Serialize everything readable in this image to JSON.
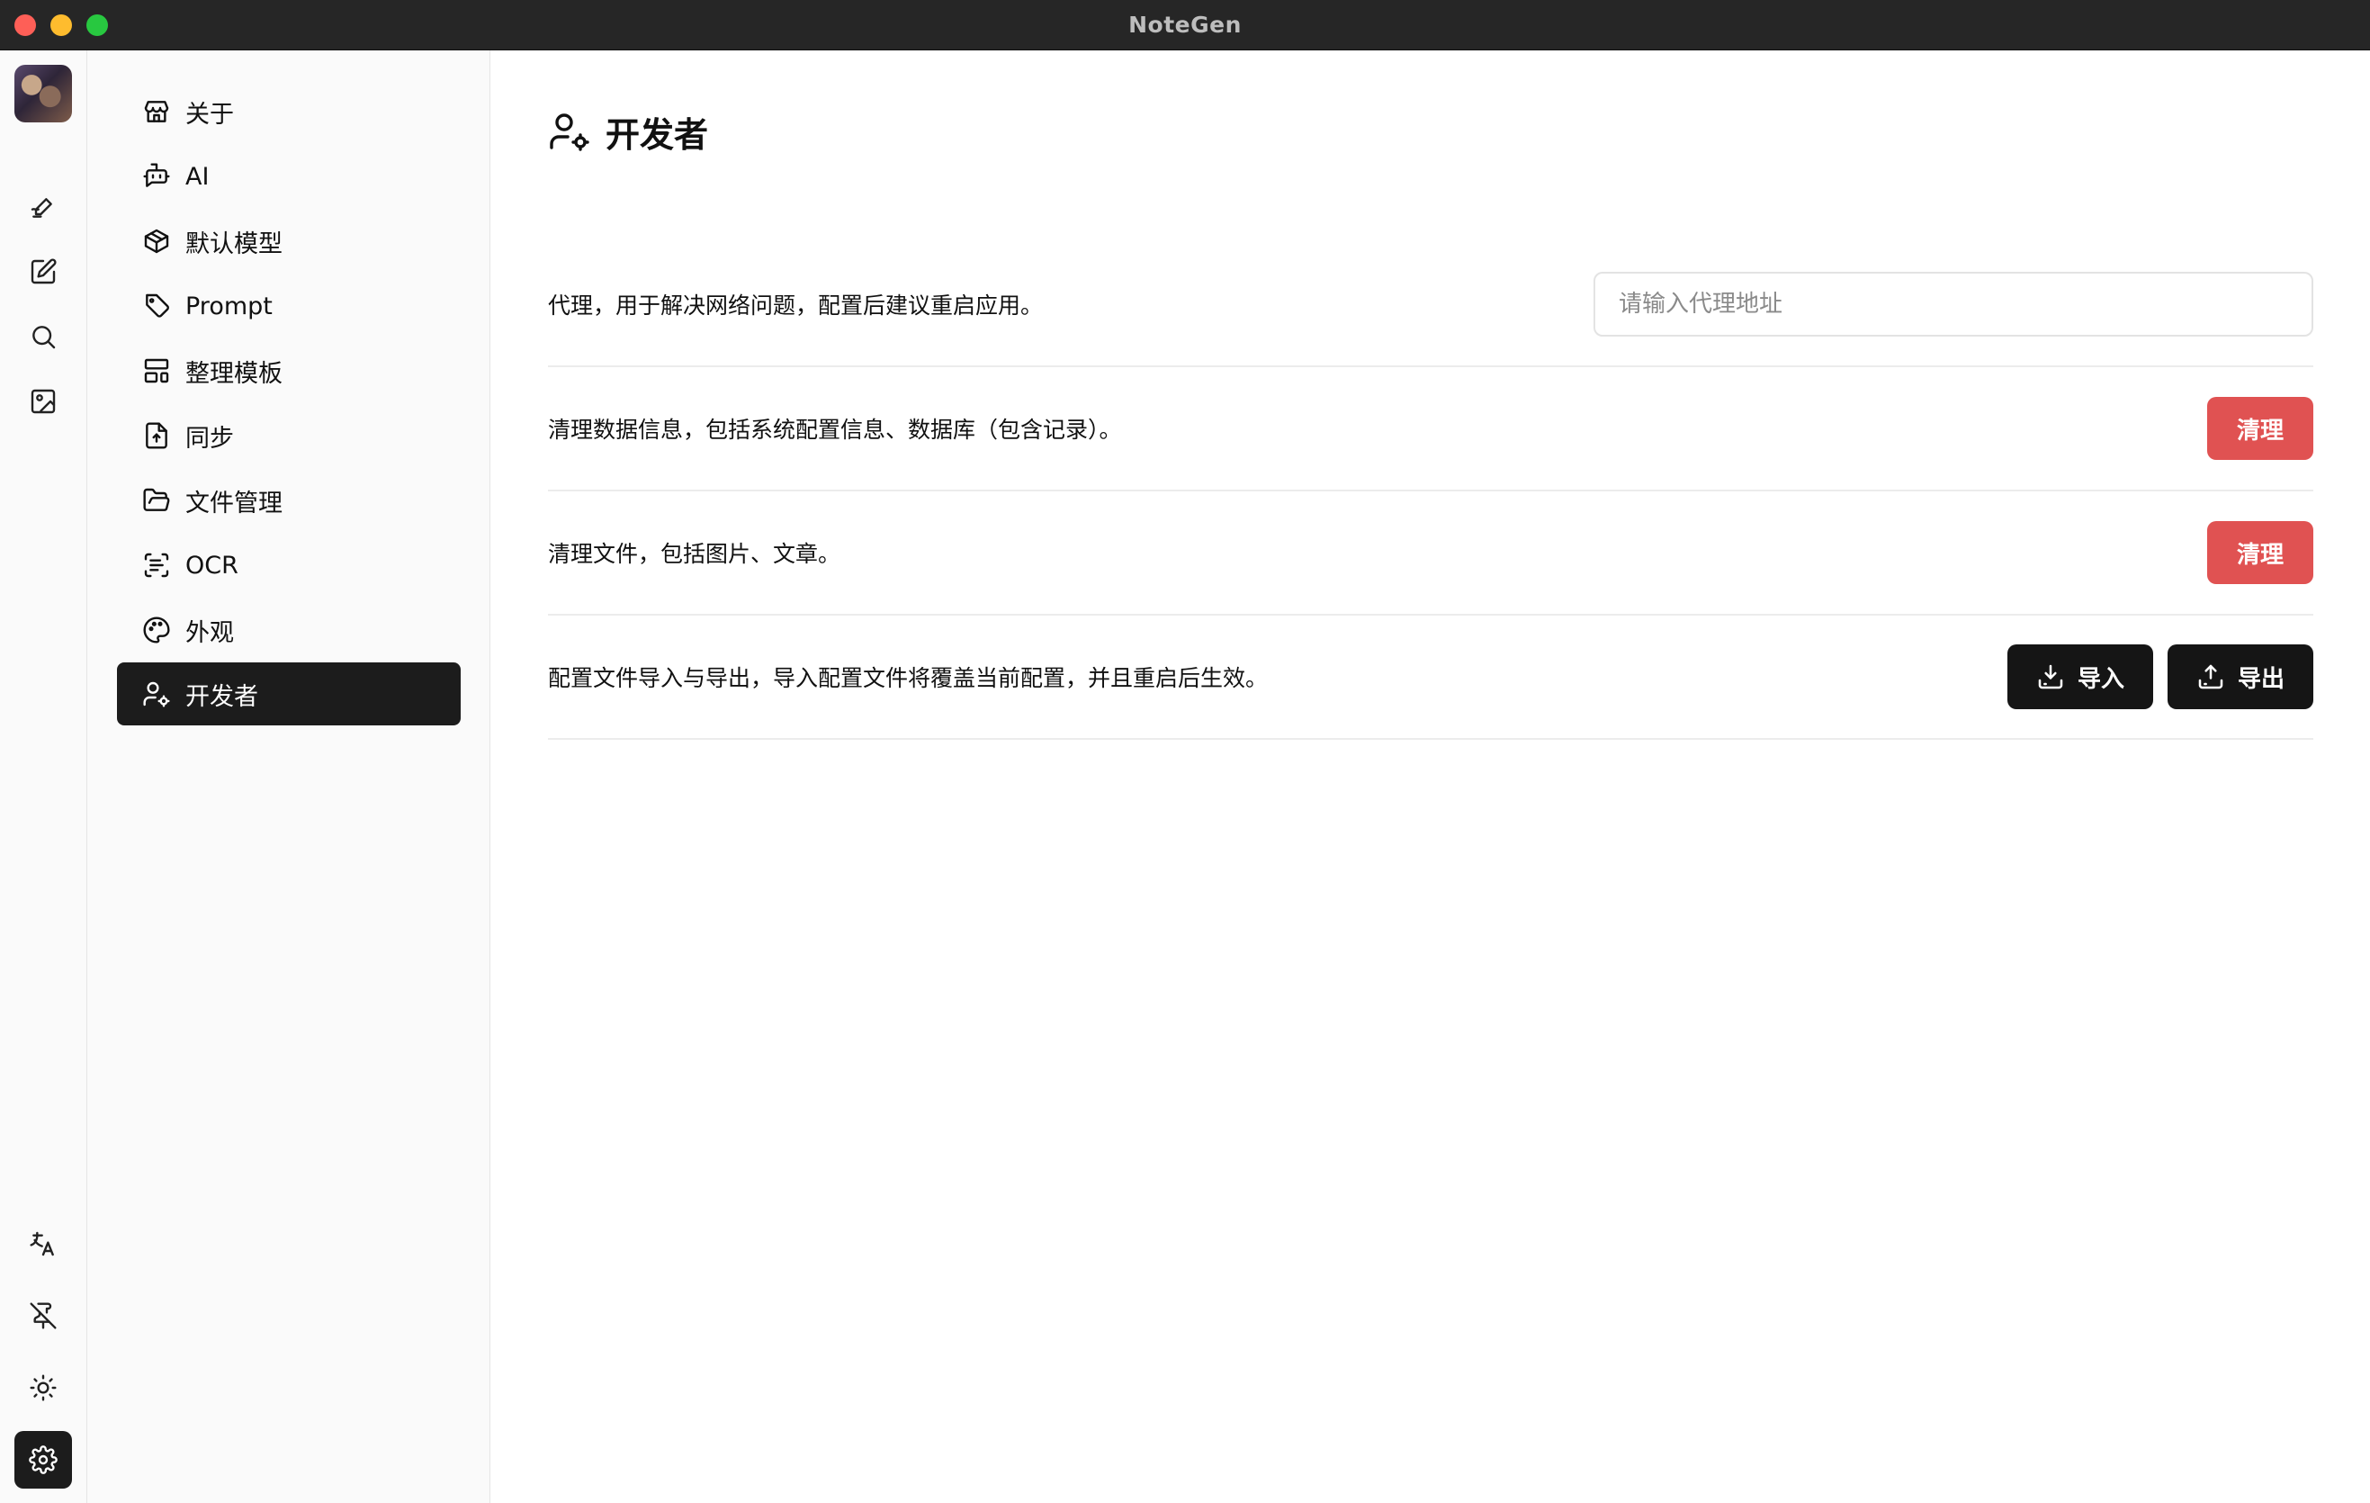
{
  "window": {
    "title": "NoteGen"
  },
  "rail": {
    "items": [
      {
        "name": "record-icon"
      },
      {
        "name": "write-icon"
      },
      {
        "name": "search-icon"
      },
      {
        "name": "image-icon"
      },
      {
        "name": "translate-icon"
      },
      {
        "name": "pin-off-icon"
      },
      {
        "name": "theme-icon"
      },
      {
        "name": "settings-icon",
        "active": true
      }
    ]
  },
  "menu": {
    "items": [
      {
        "label": "关于",
        "icon": "store-icon"
      },
      {
        "label": "AI",
        "icon": "bot-message-icon"
      },
      {
        "label": "默认模型",
        "icon": "box-icon"
      },
      {
        "label": "Prompt",
        "icon": "tag-icon"
      },
      {
        "label": "整理模板",
        "icon": "layout-template-icon"
      },
      {
        "label": "同步",
        "icon": "file-sync-icon"
      },
      {
        "label": "文件管理",
        "icon": "folder-open-icon"
      },
      {
        "label": "OCR",
        "icon": "scan-text-icon"
      },
      {
        "label": "外观",
        "icon": "palette-icon"
      },
      {
        "label": "开发者",
        "icon": "user-cog-icon",
        "active": true
      }
    ]
  },
  "page": {
    "title": "开发者",
    "proxy": {
      "description": "代理，用于解决网络问题，配置后建议重启应用。",
      "placeholder": "请输入代理地址",
      "value": ""
    },
    "clear_data": {
      "description": "清理数据信息，包括系统配置信息、数据库（包含记录）。",
      "button_label": "清理"
    },
    "clear_files": {
      "description": "清理文件，包括图片、文章。",
      "button_label": "清理"
    },
    "config_io": {
      "description": "配置文件导入与导出，导入配置文件将覆盖当前配置，并且重启后生效。",
      "import_label": "导入",
      "export_label": "导出"
    }
  },
  "colors": {
    "danger": "#e05252",
    "dark": "#151515",
    "titlebar": "#262626"
  }
}
